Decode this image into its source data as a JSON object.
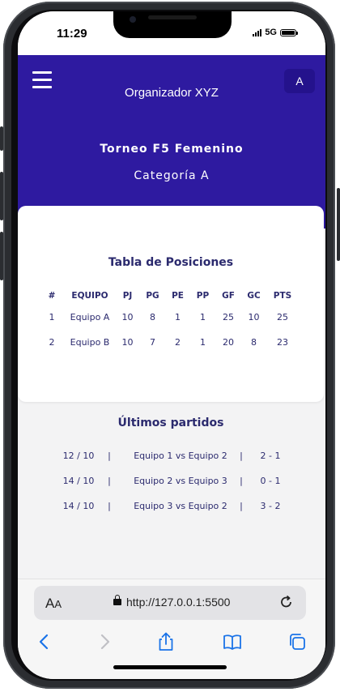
{
  "status_bar": {
    "time": "11:29",
    "network": "5G"
  },
  "header": {
    "org_name": "Organizador XYZ",
    "avatar_initial": "A",
    "tournament_title": "Torneo F5 Femenino",
    "category": "Categoría A",
    "color": "#2e1aa0"
  },
  "standings": {
    "title": "Tabla de Posiciones",
    "columns": [
      "#",
      "EQUIPO",
      "PJ",
      "PG",
      "PE",
      "PP",
      "GF",
      "GC",
      "PTS"
    ],
    "rows": [
      [
        "1",
        "Equipo A",
        "10",
        "8",
        "1",
        "1",
        "25",
        "10",
        "25"
      ],
      [
        "2",
        "Equipo B",
        "10",
        "7",
        "2",
        "1",
        "20",
        "8",
        "23"
      ]
    ]
  },
  "matches": {
    "title": "Últimos partidos",
    "separator": "|",
    "items": [
      {
        "date": "12 / 10",
        "teams": "Equipo 1 vs Equipo 2",
        "score": "2 - 1"
      },
      {
        "date": "14 / 10",
        "teams": "Equipo 2 vs Equipo 3",
        "score": "0 - 1"
      },
      {
        "date": "14 / 10",
        "teams": "Equipo 3 vs Equipo 2",
        "score": "3 - 2"
      }
    ]
  },
  "browser": {
    "text_size_big": "A",
    "text_size_small": "A",
    "url": "http://127.0.0.1:5500",
    "icons": [
      "lock-icon",
      "reload-icon",
      "back-icon",
      "forward-icon",
      "share-icon",
      "bookmarks-icon",
      "tabs-icon"
    ],
    "accent": "#1a73e8"
  }
}
